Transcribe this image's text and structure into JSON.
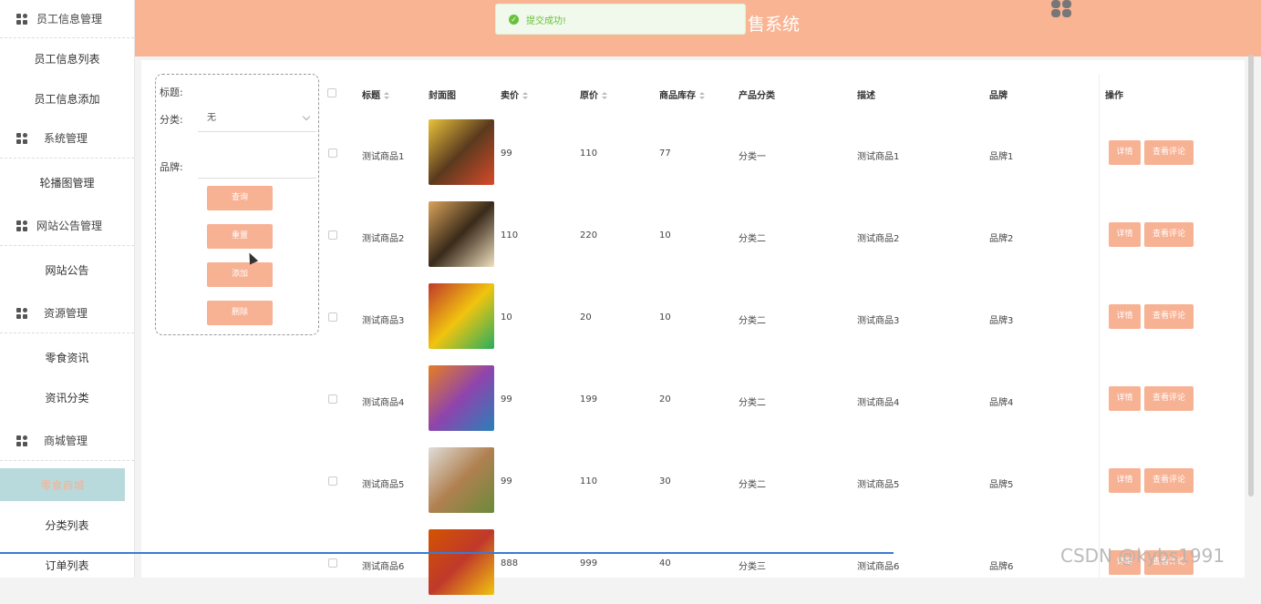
{
  "header": {
    "title": "售系统"
  },
  "toast": {
    "message": "提交成功!"
  },
  "sidebar": {
    "groups": [
      {
        "label": "员工信息管理",
        "items": [
          "员工信息列表",
          "员工信息添加"
        ]
      },
      {
        "label": "系统管理",
        "items": [
          "轮播图管理"
        ]
      },
      {
        "label": "网站公告管理",
        "items": [
          "网站公告"
        ]
      },
      {
        "label": "资源管理",
        "items": [
          "零食资讯",
          "资讯分类"
        ]
      },
      {
        "label": "商城管理",
        "items": [
          "零食商城",
          "分类列表",
          "订单列表"
        ]
      }
    ],
    "active_item": "零食商城"
  },
  "search": {
    "title_label": "标题:",
    "category_label": "分类:",
    "category_value": "无",
    "brand_label": "品牌:",
    "buttons": {
      "query": "查询",
      "reset": "重置",
      "add": "添加",
      "delete": "删除"
    }
  },
  "table": {
    "headers": {
      "title": "标题",
      "cover": "封面图",
      "price": "卖价",
      "original": "原价",
      "stock": "商品库存",
      "category": "产品分类",
      "desc": "描述",
      "brand": "品牌",
      "ops": "操作"
    },
    "rows": [
      {
        "title": "测试商品1",
        "price": "99",
        "original": "110",
        "stock": "77",
        "category": "分类一",
        "desc": "测试商品1",
        "brand": "品牌1"
      },
      {
        "title": "测试商品2",
        "price": "110",
        "original": "220",
        "stock": "10",
        "category": "分类二",
        "desc": "测试商品2",
        "brand": "品牌2"
      },
      {
        "title": "测试商品3",
        "price": "10",
        "original": "20",
        "stock": "10",
        "category": "分类二",
        "desc": "测试商品3",
        "brand": "品牌3"
      },
      {
        "title": "测试商品4",
        "price": "99",
        "original": "199",
        "stock": "20",
        "category": "分类二",
        "desc": "测试商品4",
        "brand": "品牌4"
      },
      {
        "title": "测试商品5",
        "price": "99",
        "original": "110",
        "stock": "30",
        "category": "分类二",
        "desc": "测试商品5",
        "brand": "品牌5"
      },
      {
        "title": "测试商品6",
        "price": "888",
        "original": "999",
        "stock": "40",
        "category": "分类三",
        "desc": "测试商品6",
        "brand": "品牌6"
      }
    ],
    "detail_label": "详情",
    "comment_label": "查看评论"
  },
  "watermark": "CSDN @kybs1991",
  "colors": {
    "accent": "#f7b193",
    "header": "#f9b493",
    "active_bg": "#b9dadd"
  }
}
